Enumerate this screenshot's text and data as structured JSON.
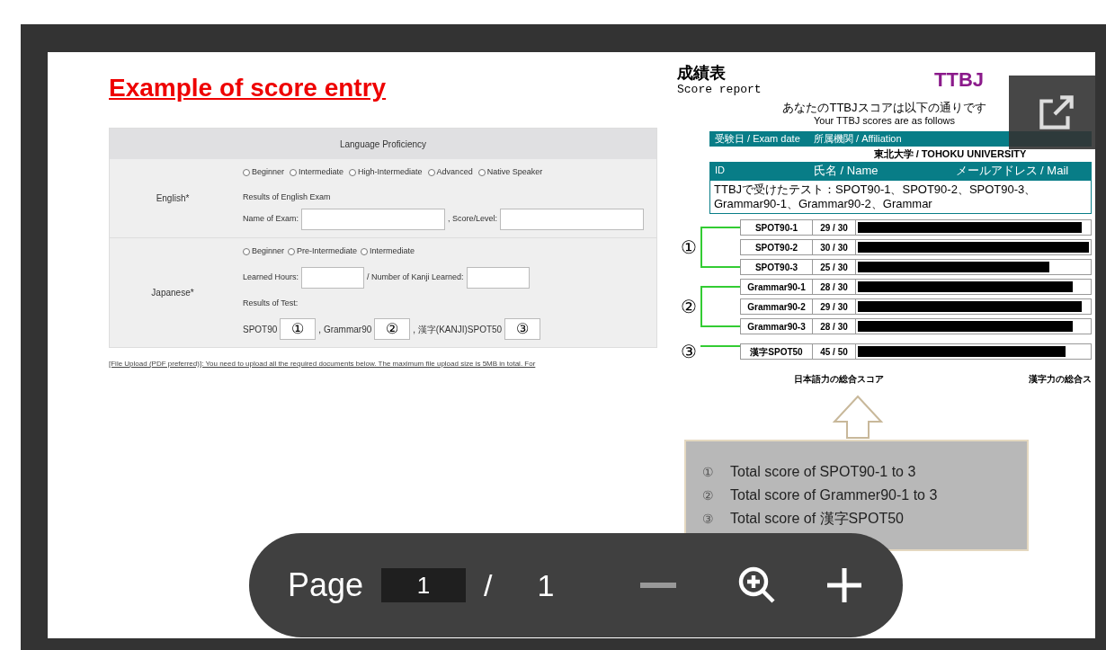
{
  "document": {
    "title": "Example of score entry",
    "form": {
      "header": "Language Proficiency",
      "english": {
        "label": "English*",
        "options": [
          {
            "label": "Beginner",
            "selected": false
          },
          {
            "label": "Intermediate",
            "selected": false
          },
          {
            "label": "High-Intermediate",
            "selected": false
          },
          {
            "label": "Advanced",
            "selected": false
          },
          {
            "label": "Native Speaker",
            "selected": false
          }
        ],
        "results_label": "Results of English Exam",
        "exam_name_label": "Name of Exam:",
        "score_label": ", Score/Level:"
      },
      "japanese": {
        "label": "Japanese*",
        "options": [
          {
            "label": "Beginner",
            "selected": false
          },
          {
            "label": "Pre-Intermediate",
            "selected": false
          },
          {
            "label": "Intermediate",
            "selected": false
          }
        ],
        "hours_label": "Learned Hours:",
        "kanji_label": "/ Number of Kanji Learned:",
        "results_label": "Results of Test:",
        "tests": [
          {
            "label": "SPOT90",
            "marker": "①"
          },
          {
            "label": ", Grammar90",
            "marker": "②"
          },
          {
            "label": ", 漢字(KANJI)SPOT50",
            "marker": "③"
          }
        ]
      }
    },
    "upload_note": "[File Upload (PDF preferred)]: You need to upload all the required documents below. The maximum file upload size is 5MB in total. For",
    "report": {
      "title": "成績表",
      "subtitle": "Score report",
      "logo": "TTBJ",
      "message_ja": "あなたのTTBJスコアは以下の通りです",
      "message_en": "Your TTBJ scores are as follows",
      "header_row": [
        "受験日 / Exam date",
        "所属機関 / Affiliation"
      ],
      "affiliation": "東北大学 / TOHOKU UNIVERSITY",
      "id_label": "ID",
      "name_row": [
        "氏名 / Name",
        "メールアドレス / Mail"
      ],
      "tests_taken": "TTBJで受けたテスト：SPOT90-1、SPOT90-2、SPOT90-3、Grammar90-1、Grammar90-2、Grammar",
      "groups": [
        {
          "marker": "①",
          "rows": [
            {
              "test": "SPOT90-1",
              "score": "29 / 30",
              "level": 0.97
            },
            {
              "test": "SPOT90-2",
              "score": "30 / 30",
              "level": 1.0
            },
            {
              "test": "SPOT90-3",
              "score": "25 / 30",
              "level": 0.83
            }
          ]
        },
        {
          "marker": "②",
          "rows": [
            {
              "test": "Grammar90-1",
              "score": "28 / 30",
              "level": 0.93
            },
            {
              "test": "Grammar90-2",
              "score": "29 / 30",
              "level": 0.97
            },
            {
              "test": "Grammar90-3",
              "score": "28 / 30",
              "level": 0.93
            }
          ]
        },
        {
          "marker": "③",
          "rows": [
            {
              "test": "漢字SPOT50",
              "score": "45 / 50",
              "level": 0.9
            }
          ]
        }
      ],
      "totals": [
        "日本語力の総合スコア",
        "漢字力の総合ス"
      ]
    },
    "legend": [
      {
        "marker": "①",
        "text": "Total score of SPOT90-1 to 3"
      },
      {
        "marker": "②",
        "text": "Total score of Grammer90-1 to 3"
      },
      {
        "marker": "③",
        "text": "Total score of 漢字SPOT50"
      }
    ]
  },
  "toolbar": {
    "page_label": "Page",
    "page_value": "1",
    "separator": "/",
    "page_count": "1"
  }
}
